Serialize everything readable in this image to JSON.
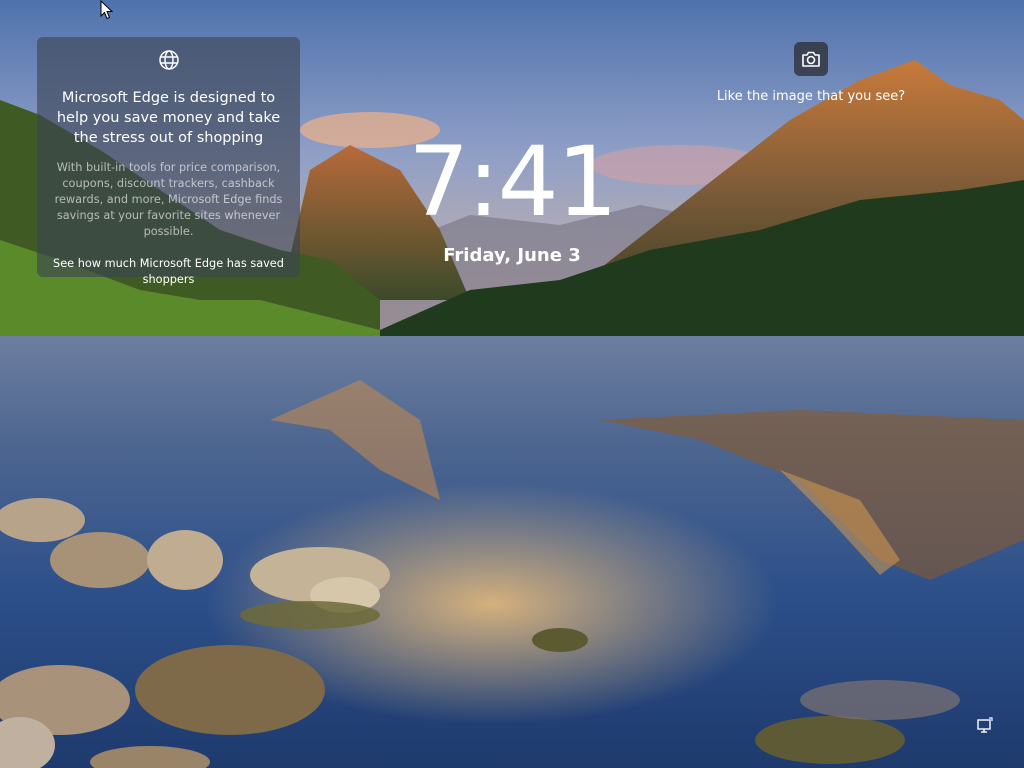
{
  "lock_screen": {
    "time": "7:41",
    "date": "Friday, June 3"
  },
  "spotlight": {
    "camera_icon": "camera-icon",
    "like_label": "Like the image that you see?"
  },
  "info_card": {
    "icon": "globe-icon",
    "title": "Microsoft Edge is designed to help you save money and take the stress out of shopping",
    "body": "With built-in tools for price comparison, coupons, discount trackers, cashback rewards, and more, Microsoft Edge finds savings at your favorite sites whenever possible.",
    "link": "See how much Microsoft Edge has saved shoppers"
  },
  "status": {
    "network_icon": "network-icon"
  },
  "colors": {
    "text": "#ffffff",
    "card_bg": "#3c4452",
    "sky": "#5a7bb0",
    "water": "#2b4f86"
  }
}
